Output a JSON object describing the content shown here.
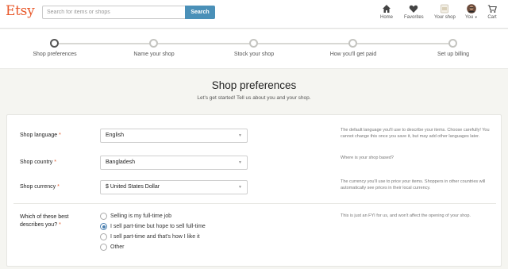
{
  "header": {
    "logo": "Etsy",
    "search_placeholder": "Search for items or shops",
    "search_button": "Search",
    "nav": [
      {
        "label": "Home",
        "icon": "home-icon"
      },
      {
        "label": "Favorites",
        "icon": "heart-icon"
      },
      {
        "label": "Your shop",
        "icon": "shop-icon"
      },
      {
        "label": "You",
        "icon": "avatar"
      },
      {
        "label": "Cart",
        "icon": "cart-icon"
      }
    ]
  },
  "stepper": {
    "steps": [
      {
        "label": "Shop preferences",
        "active": true
      },
      {
        "label": "Name your shop",
        "active": false
      },
      {
        "label": "Stock your shop",
        "active": false
      },
      {
        "label": "How you'll get paid",
        "active": false
      },
      {
        "label": "Set up billing",
        "active": false
      }
    ]
  },
  "main": {
    "title": "Shop preferences",
    "subtitle": "Let's get started! Tell us about you and your shop."
  },
  "form": {
    "language": {
      "label": "Shop language",
      "required_mark": "*",
      "value": "English",
      "help": "The default language you'll use to describe your items. Choose carefully! You cannot change this once you save it, but may add other languages later."
    },
    "country": {
      "label": "Shop country",
      "required_mark": "*",
      "value": "Bangladesh",
      "help": "Where is your shop based?"
    },
    "currency": {
      "label": "Shop currency",
      "required_mark": "*",
      "value": "$ United States Dollar",
      "help": "The currency you'll use to price your items. Shoppers in other countries will automatically see prices in their local currency."
    },
    "describe": {
      "label_line1": "Which of these best",
      "label_line2": "describes you?",
      "required_mark": "*",
      "help": "This is just an FYI for us, and won't affect the opening of your shop.",
      "options": [
        {
          "label": "Selling is my full-time job",
          "checked": false
        },
        {
          "label": "I sell part-time but hope to sell full-time",
          "checked": true
        },
        {
          "label": "I sell part-time and that's how I like it",
          "checked": false
        },
        {
          "label": "Other",
          "checked": false
        }
      ]
    }
  },
  "colors": {
    "brand": "#e8582a",
    "search_button": "#4a90b8",
    "required": "#e05a2b",
    "radio_checked": "#4a7fb0"
  }
}
